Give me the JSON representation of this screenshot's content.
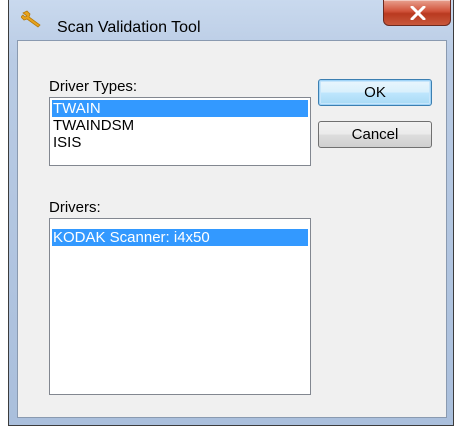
{
  "window": {
    "title": "Scan Validation Tool",
    "icon": "wrench-icon",
    "close_icon": "close-icon"
  },
  "driver_types": {
    "label": "Driver Types:",
    "items": [
      "TWAIN",
      "TWAINDSM",
      "ISIS"
    ],
    "selected": "TWAIN"
  },
  "drivers": {
    "label": "Drivers:",
    "items": [
      "KODAK Scanner: i4x50"
    ],
    "selected": "KODAK Scanner: i4x50"
  },
  "buttons": {
    "ok_label": "OK",
    "cancel_label": "Cancel"
  },
  "colors": {
    "selection": "#3399ff",
    "close_button": "#c8452c",
    "title_icon": "#e8a31c"
  }
}
